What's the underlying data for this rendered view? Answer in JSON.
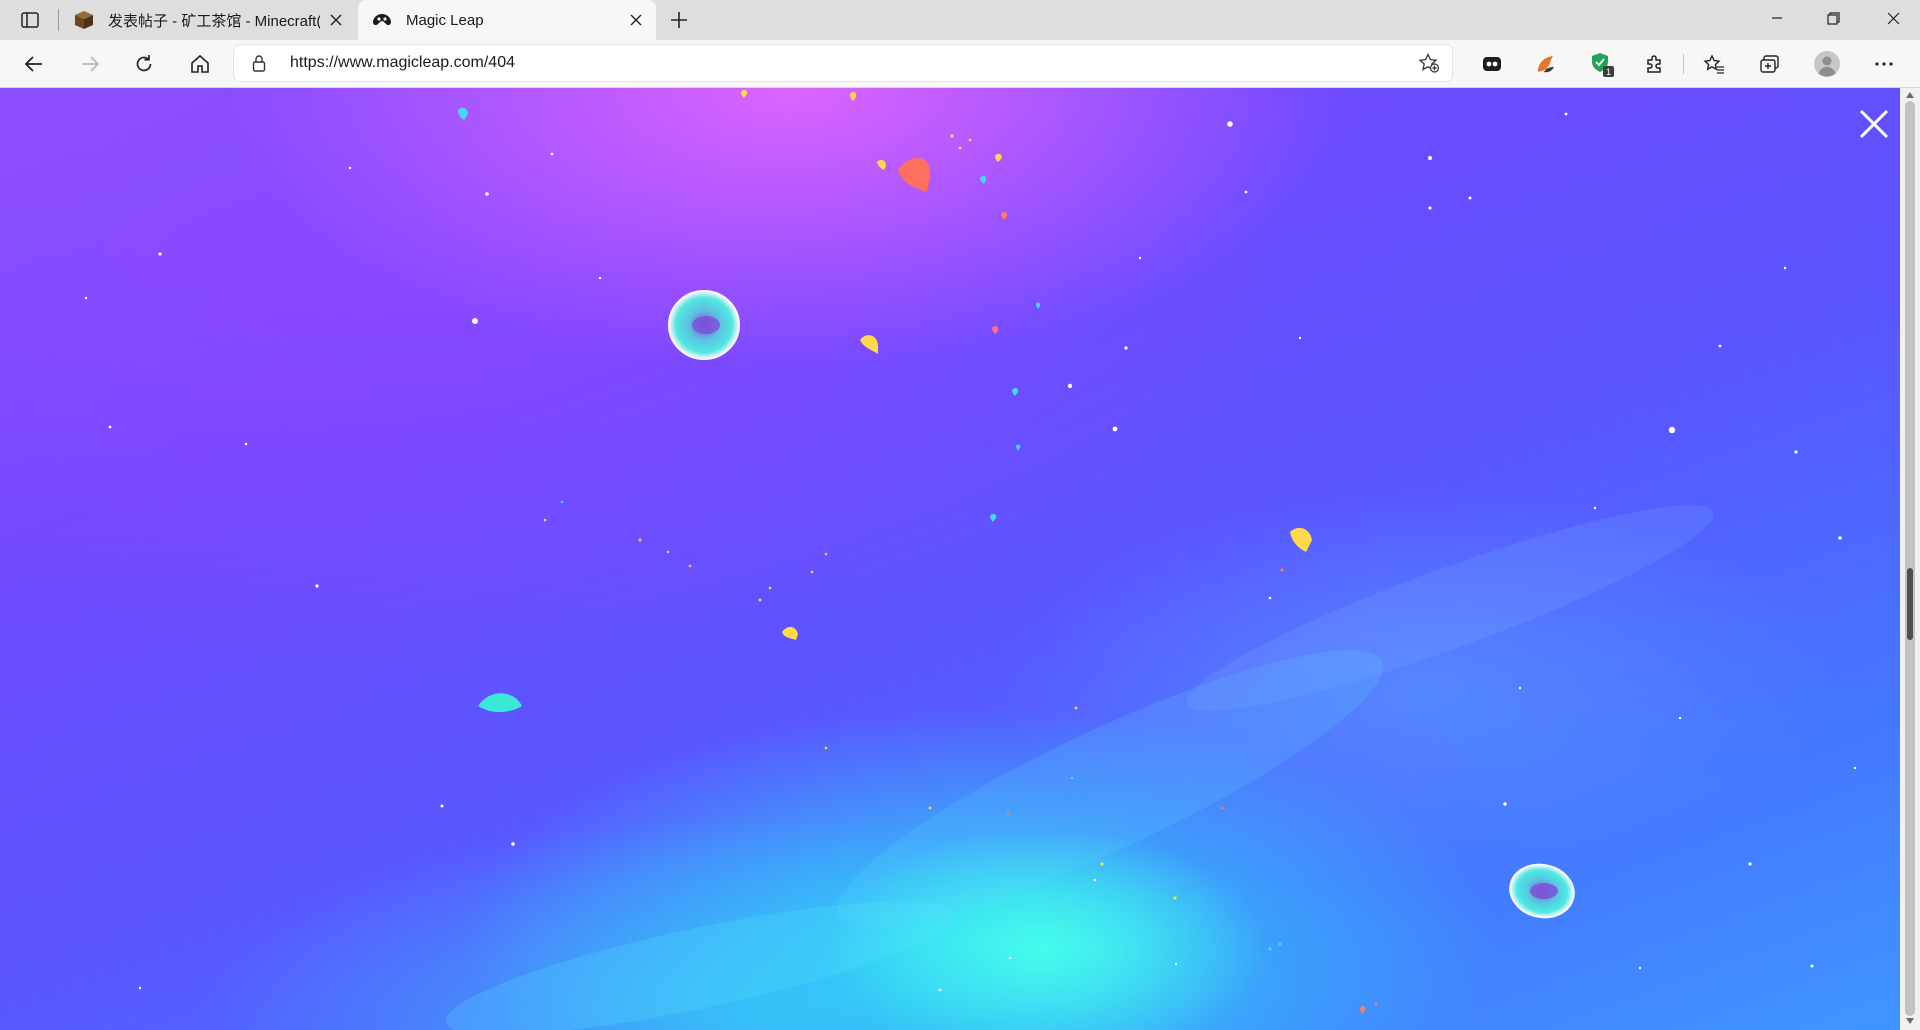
{
  "browser": {
    "tabs": [
      {
        "title": "发表帖子 - 矿工茶馆 - Minecraft(",
        "active": false,
        "favicon": "minecraft-block-icon"
      },
      {
        "title": "Magic Leap",
        "active": true,
        "favicon": "magic-leap-icon"
      }
    ],
    "address_bar": {
      "url": "https://www.magicleap.com/404"
    },
    "extensions": {
      "badge_count": "1"
    },
    "icons": [
      "tab-actions-icon",
      "close-icon",
      "new-tab-icon",
      "minimize-icon",
      "restore-icon",
      "back-icon",
      "forward-icon",
      "refresh-icon",
      "home-icon",
      "lock-icon",
      "add-favorite-icon",
      "extensions-icon",
      "favorites-icon",
      "collections-icon",
      "profile-icon",
      "more-icon"
    ]
  },
  "page": {
    "close_label": "✕",
    "colors": {
      "nebula_purple": "#8a52ff",
      "nebula_blue": "#4477ff",
      "nebula_cyan": "#46ffeb",
      "accent_coral": "#ff6f5e",
      "accent_yellow": "#ffd94a"
    }
  }
}
